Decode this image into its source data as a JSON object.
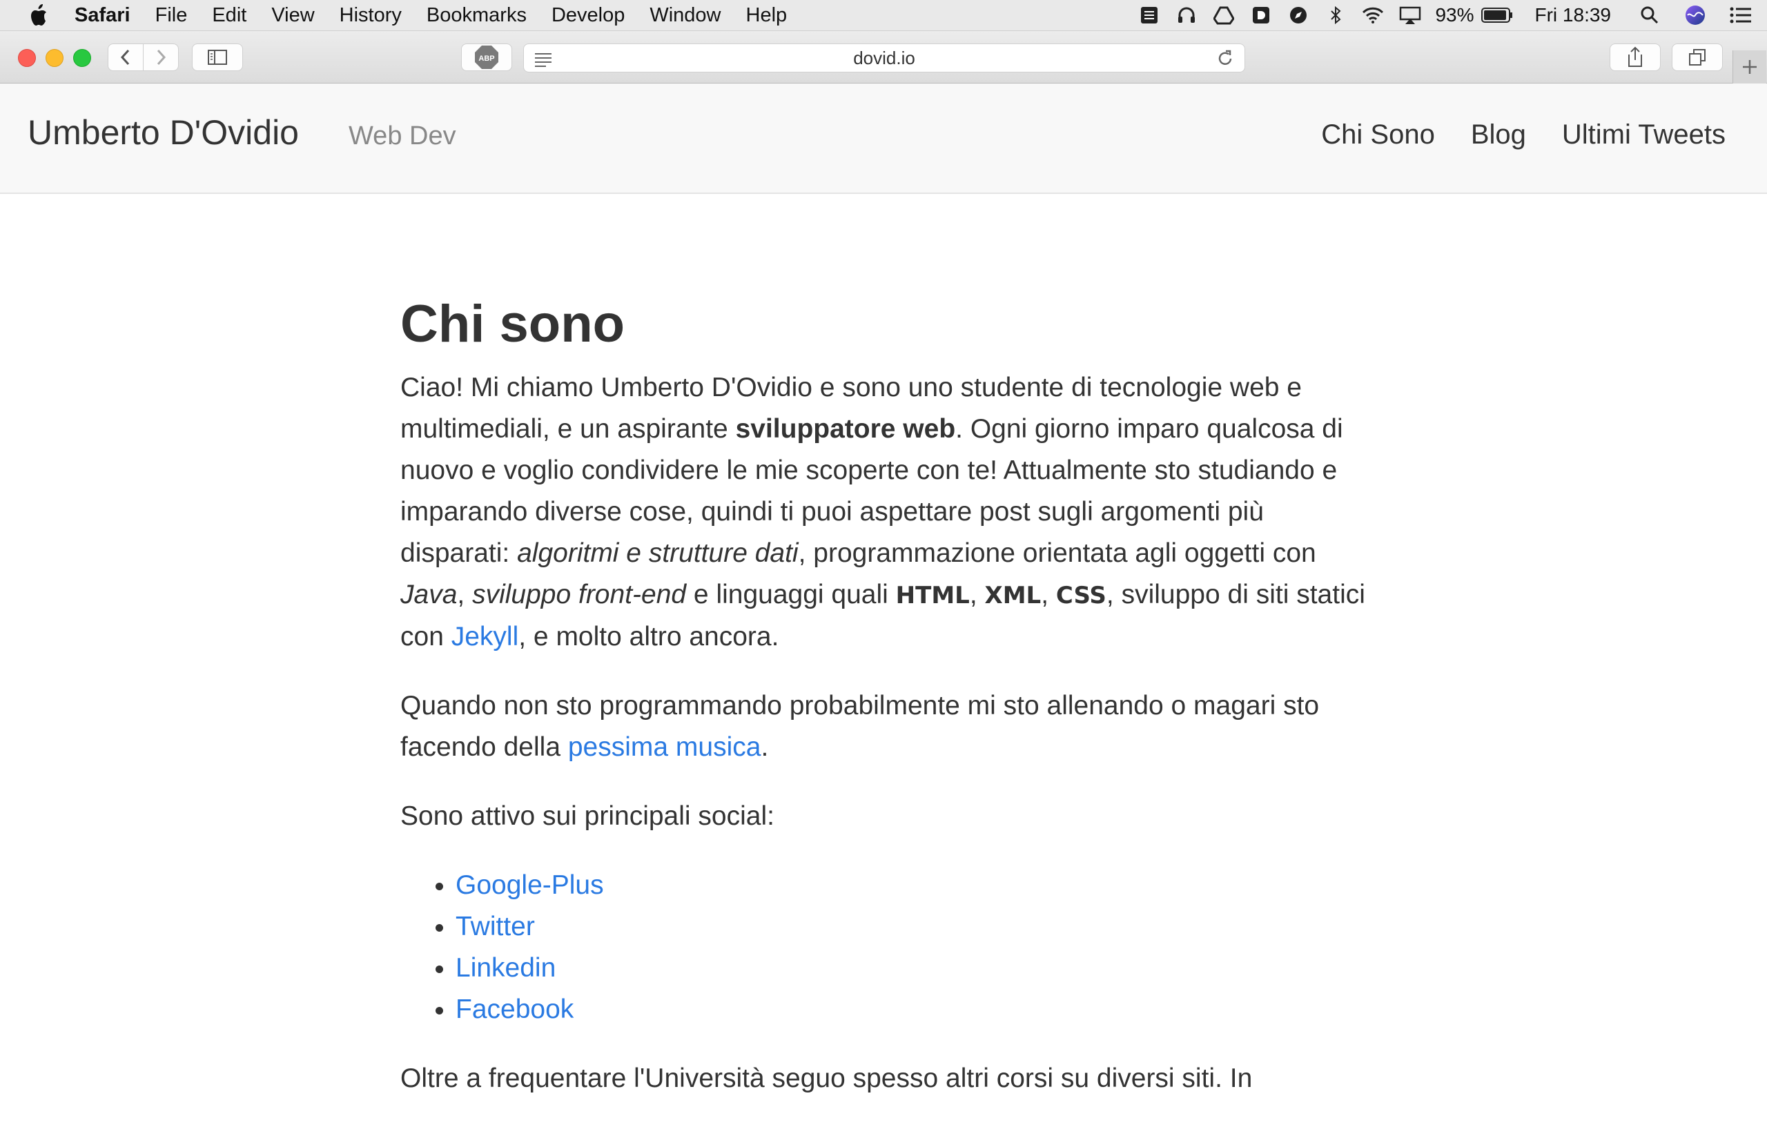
{
  "menubar": {
    "items": [
      "Safari",
      "File",
      "Edit",
      "View",
      "History",
      "Bookmarks",
      "Develop",
      "Window",
      "Help"
    ],
    "battery": "93%",
    "clock": "Fri 18:39",
    "icons": [
      "tray-icon",
      "headphones-icon",
      "drive-icon",
      "app-icon",
      "compass-icon",
      "bluetooth-icon",
      "wifi-icon",
      "airplay-icon",
      "battery-icon",
      "search-icon",
      "siri-icon",
      "list-icon"
    ]
  },
  "browser": {
    "url": "dovid.io",
    "adblock_label": "ABP"
  },
  "site": {
    "title": "Umberto D'Ovidio",
    "subtitle": "Web Dev",
    "nav": [
      "Chi Sono",
      "Blog",
      "Ultimi Tweets"
    ]
  },
  "content": {
    "heading": "Chi sono",
    "p1": {
      "t1": "Ciao! Mi chiamo Umberto D'Ovidio e sono uno studente di tecnologie web e multimediali, e un aspirante ",
      "b1": "sviluppatore web",
      "t2": ". Ogni giorno imparo qualcosa di nuovo e voglio condividere le mie scoperte con te! Attualmente sto studiando e imparando diverse cose, quindi ti puoi aspettare post sugli argomenti più disparati: ",
      "i1": "algoritmi e strutture dati",
      "t3": ", programmazione orientata agli oggetti con ",
      "i2": "Java",
      "t4": ", ",
      "i3": "sviluppo front-end",
      "t5": " e linguaggi quali ",
      "c1": "HTML",
      "s1": ", ",
      "c2": "XML",
      "s2": ", ",
      "c3": "CSS",
      "t6": ", sviluppo di siti statici con ",
      "link": "Jekyll",
      "t7": ", e molto altro ancora."
    },
    "p2": {
      "t1": "Quando non sto programmando probabilmente mi sto allenando o magari sto facendo della ",
      "link": "pessima musica",
      "t2": "."
    },
    "p3": "Sono attivo sui principali social:",
    "socials": [
      "Google-Plus",
      "Twitter",
      "Linkedin",
      "Facebook"
    ],
    "p4": "Oltre a frequentare l'Università seguo spesso altri corsi su diversi siti. In"
  },
  "colors": {
    "link": "#2a7ae2",
    "text": "#333333",
    "header_bg": "#f8f8f8"
  }
}
